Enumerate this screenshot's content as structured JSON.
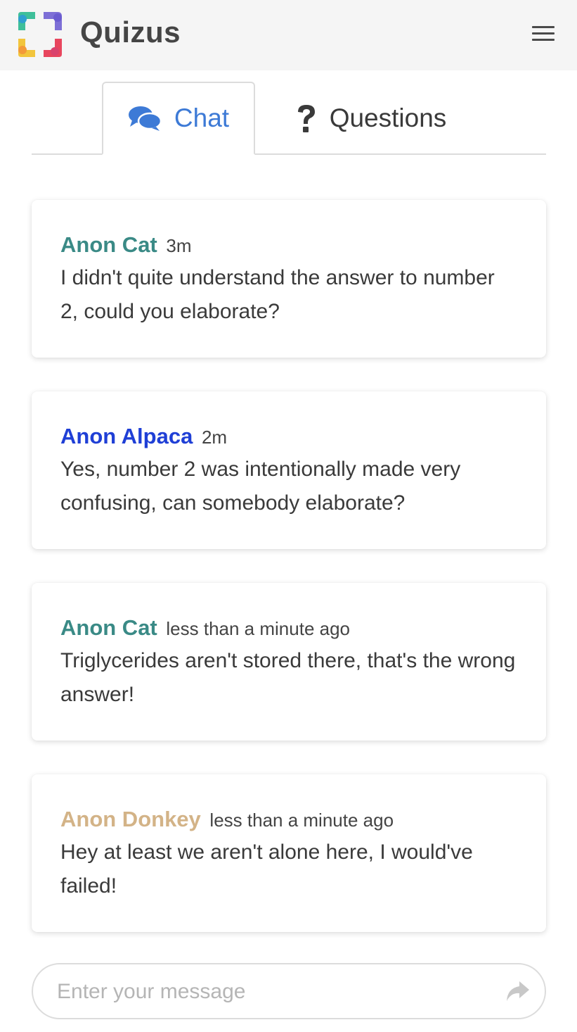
{
  "app": {
    "title": "Quizus",
    "logo_icon": "quizus-logo-icon",
    "menu_icon": "hamburger-menu-icon"
  },
  "tabs": [
    {
      "label": "Chat",
      "icon": "chat-bubbles-icon",
      "active": true,
      "color": "#3d7ad6"
    },
    {
      "label": "Questions",
      "icon": "question-mark-icon",
      "active": false
    }
  ],
  "messages": [
    {
      "author": "Anon Cat",
      "time": "3m",
      "text": "I didn't quite understand the answer to number 2, could you elaborate?",
      "color": "#3a8a86"
    },
    {
      "author": "Anon Alpaca",
      "time": "2m",
      "text": "Yes, number 2 was intentionally made very confusing, can somebody elaborate?",
      "color": "#1f3fd6"
    },
    {
      "author": "Anon Cat",
      "time": "less than a minute ago",
      "text": "Triglycerides aren't stored there, that's the wrong answer!",
      "color": "#3a8a86"
    },
    {
      "author": "Anon Donkey",
      "time": "less than a minute ago",
      "text": "Hey at least we aren't alone here, I would've failed!",
      "color": "#d3b387"
    }
  ],
  "composer": {
    "placeholder": "Enter your message",
    "value": "",
    "send_icon": "share-arrow-icon"
  }
}
